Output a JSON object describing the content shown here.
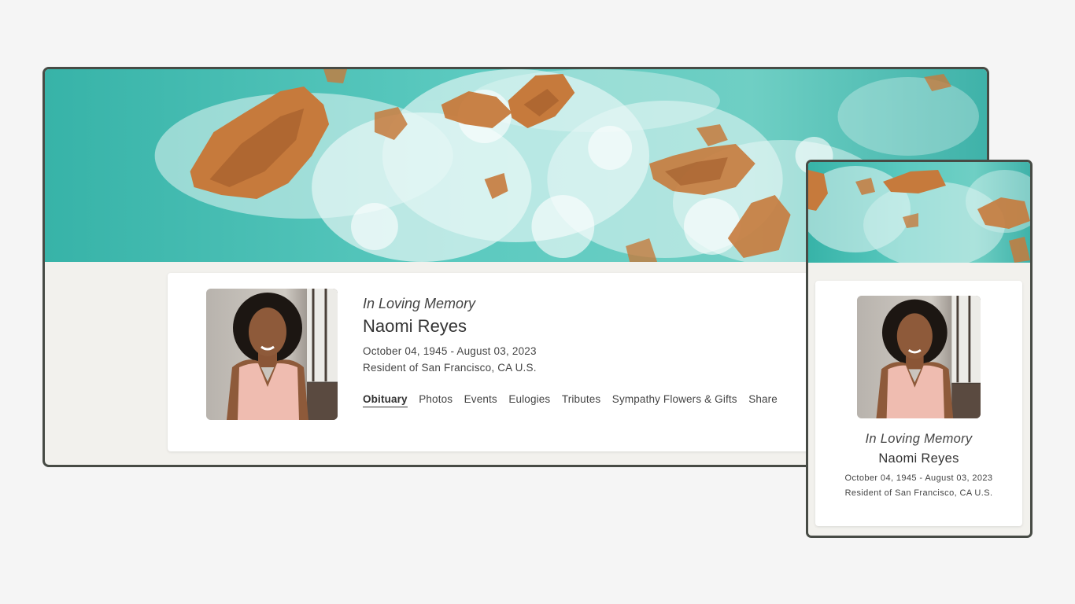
{
  "profile": {
    "heading": "In Loving Memory",
    "name": "Naomi Reyes",
    "dates": "October 04, 1945 - August 03, 2023",
    "residence": "Resident of San Francisco, CA U.S."
  },
  "nav": {
    "items": [
      "Obituary",
      "Photos",
      "Events",
      "Eulogies",
      "Tributes",
      "Sympathy Flowers & Gifts",
      "Share"
    ],
    "active": "Obituary"
  },
  "images": {
    "banner": "aerial-ocean-rocks-photo",
    "portrait": "portrait-photo"
  },
  "colors": {
    "background": "#f5f5f5",
    "frame_border": "#474b45",
    "page_background": "#f2f1ed",
    "card_background": "#ffffff",
    "water": "#3fbcb0",
    "rock": "#c67a3c"
  }
}
